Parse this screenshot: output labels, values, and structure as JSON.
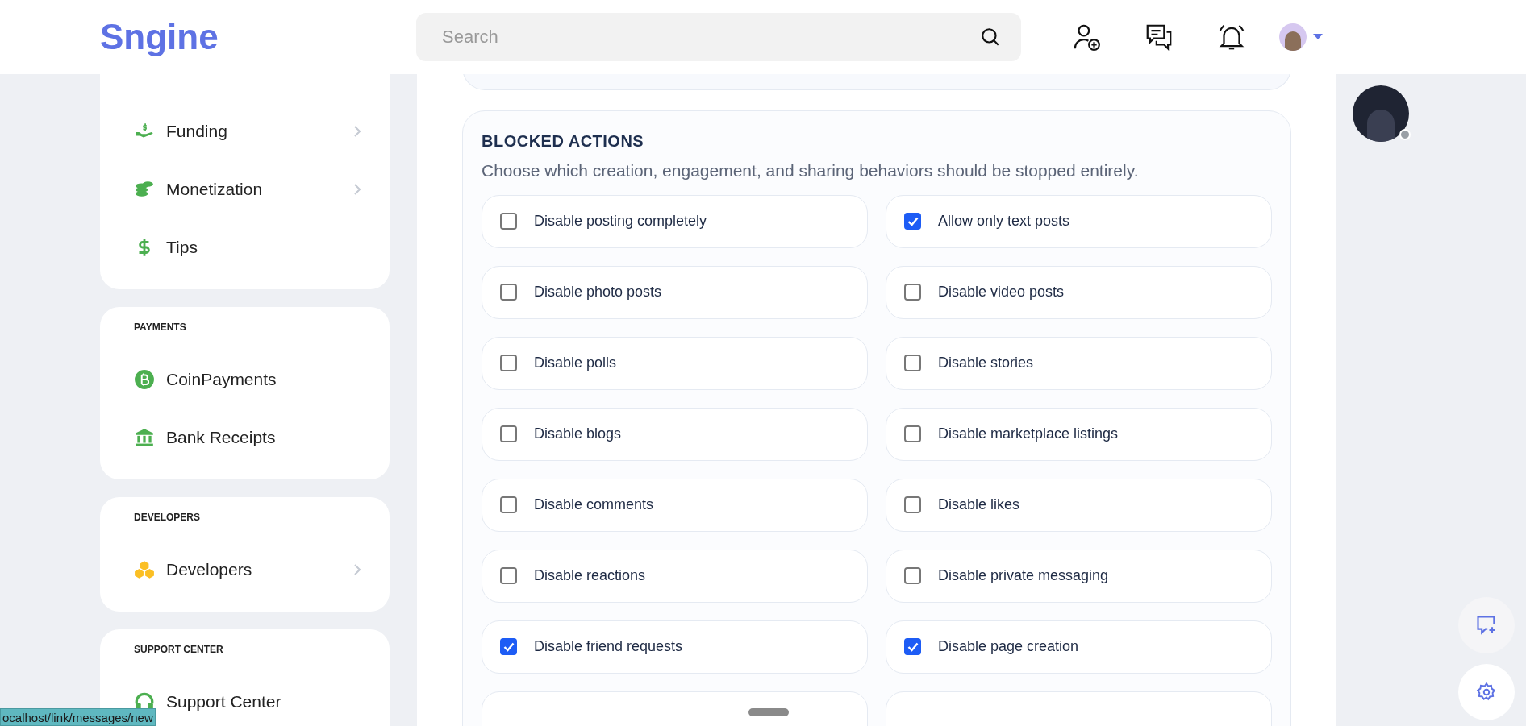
{
  "header": {
    "logo": "Sngine",
    "search": {
      "placeholder": "Search"
    }
  },
  "sidebar": {
    "sections": [
      {
        "items": [
          {
            "label": "Funding",
            "has_submenu": true
          },
          {
            "label": "Monetization",
            "has_submenu": true
          },
          {
            "label": "Tips",
            "has_submenu": false
          }
        ]
      },
      {
        "title": "PAYMENTS",
        "items": [
          {
            "label": "CoinPayments",
            "has_submenu": false
          },
          {
            "label": "Bank Receipts",
            "has_submenu": false
          }
        ]
      },
      {
        "title": "DEVELOPERS",
        "items": [
          {
            "label": "Developers",
            "has_submenu": true
          }
        ]
      },
      {
        "title": "SUPPORT CENTER",
        "items": [
          {
            "label": "Support Center",
            "has_submenu": false
          }
        ]
      }
    ]
  },
  "blocked_actions": {
    "title": "BLOCKED ACTIONS",
    "description": "Choose which creation, engagement, and sharing behaviors should be stopped entirely.",
    "options": [
      {
        "label": "Disable posting completely",
        "checked": false
      },
      {
        "label": "Allow only text posts",
        "checked": true
      },
      {
        "label": "Disable photo posts",
        "checked": false
      },
      {
        "label": "Disable video posts",
        "checked": false
      },
      {
        "label": "Disable polls",
        "checked": false
      },
      {
        "label": "Disable stories",
        "checked": false
      },
      {
        "label": "Disable blogs",
        "checked": false
      },
      {
        "label": "Disable marketplace listings",
        "checked": false
      },
      {
        "label": "Disable comments",
        "checked": false
      },
      {
        "label": "Disable likes",
        "checked": false
      },
      {
        "label": "Disable reactions",
        "checked": false
      },
      {
        "label": "Disable private messaging",
        "checked": false
      },
      {
        "label": "Disable friend requests",
        "checked": true
      },
      {
        "label": "Disable page creation",
        "checked": true
      }
    ]
  },
  "status_link": "ocalhost/link/messages/new"
}
